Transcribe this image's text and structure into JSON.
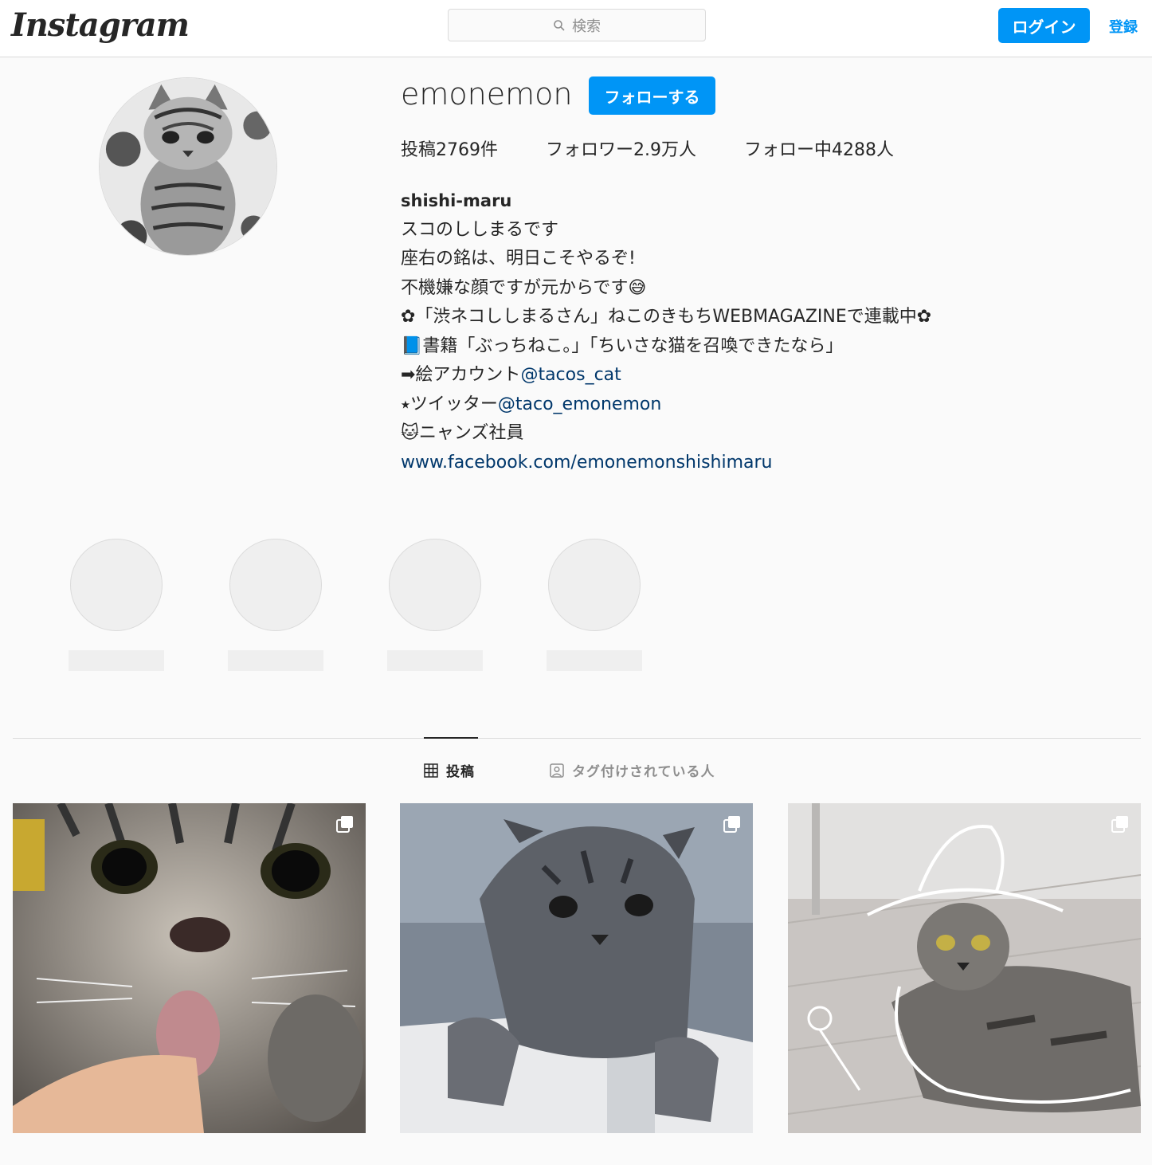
{
  "header": {
    "logo": "Instagram",
    "search_placeholder": "検索",
    "login_label": "ログイン",
    "signup_label": "登録"
  },
  "profile": {
    "username": "emonemon",
    "follow_label": "フォローする",
    "stats": {
      "posts": "投稿2769件",
      "followers": "フォロワー2.9万人",
      "following": "フォロー中4288人"
    },
    "full_name": "shishi-maru",
    "bio": {
      "line1": "スコのししまるです",
      "line2": "座右の銘は、明日こそやるぞ!",
      "line3": "不機嫌な顔ですが元からです😅",
      "line4": "✿「渋ネコししまるさん」ねこのきもちWEBMAGAZINEで連載中✿",
      "line5": "📘書籍「ぶっちねこ。」「ちいさな猫を召喚できたなら」",
      "line6_prefix": "➡絵アカウント",
      "line6_link": "@tacos_cat",
      "line7_prefix": "⭑ツイッター",
      "line7_link": "@taco_emonemon",
      "line8": "🐱ニャンズ社員"
    },
    "website": "www.facebook.com/emonemonshishimaru"
  },
  "tabs": {
    "posts_label": "投稿",
    "tagged_label": "タグ付けされている人"
  },
  "icons": {
    "search": "search-icon",
    "grid": "grid-icon",
    "tagged": "tagged-icon",
    "multi": "multiple-posts-icon"
  },
  "colors": {
    "accent": "#0095f6",
    "link": "#00376b",
    "border": "#dbdbdb",
    "background": "#fafafa"
  }
}
